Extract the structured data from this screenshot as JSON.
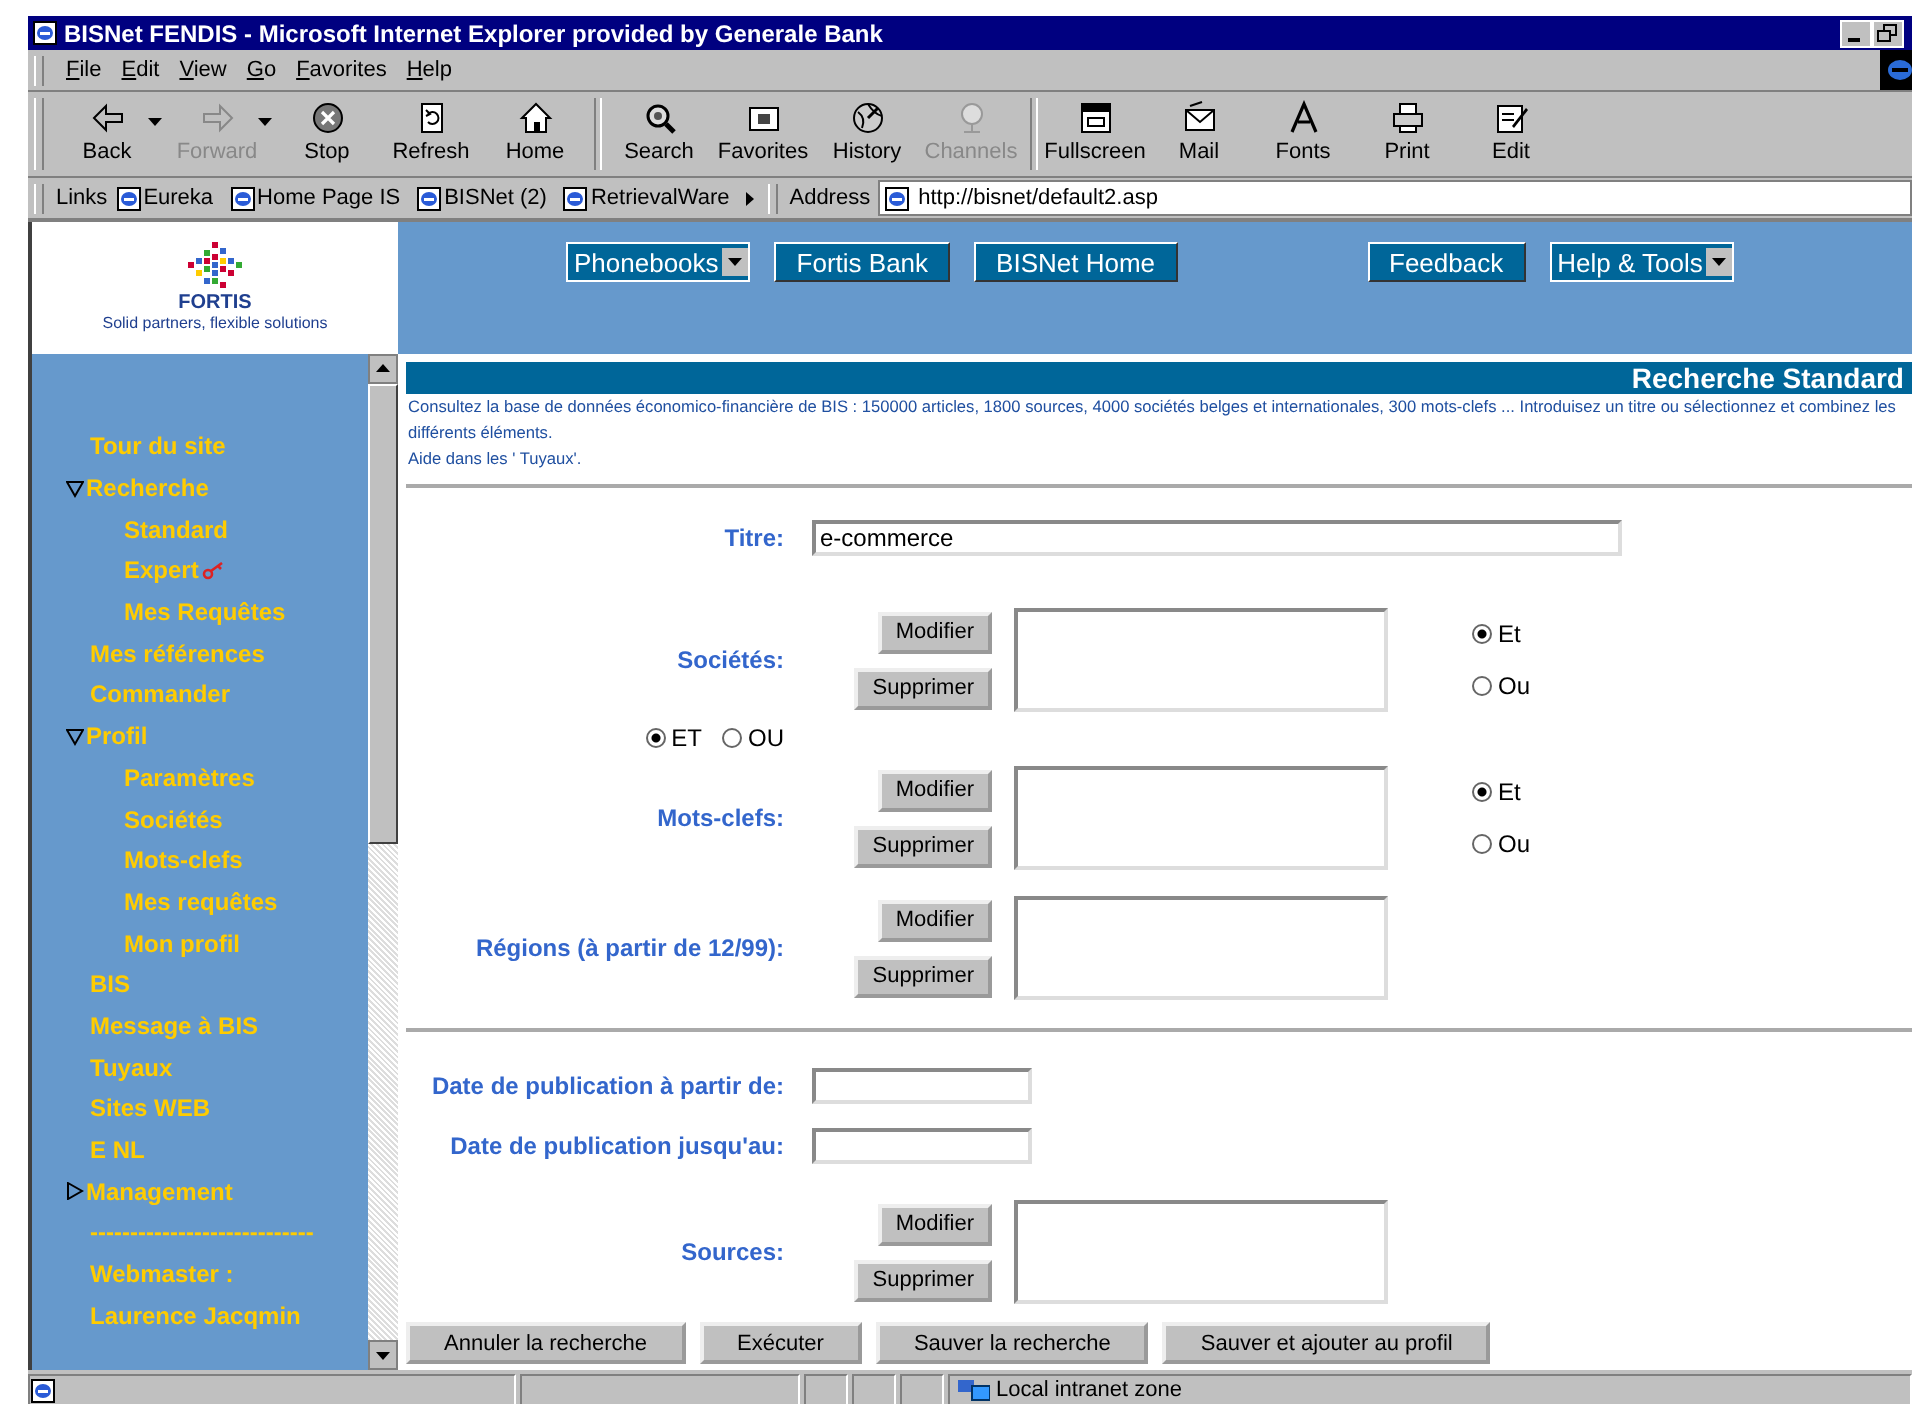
{
  "window": {
    "title": "BISNet FENDIS - Microsoft Internet Explorer provided by Generale Bank"
  },
  "menu": [
    "File",
    "Edit",
    "View",
    "Go",
    "Favorites",
    "Help"
  ],
  "toolbar": [
    [
      {
        "label": "Back",
        "disabled": false,
        "has_menu": true
      },
      {
        "label": "Forward",
        "disabled": true,
        "has_menu": true
      },
      {
        "label": "Stop",
        "disabled": false,
        "has_menu": false
      },
      {
        "label": "Refresh",
        "disabled": false,
        "has_menu": false
      },
      {
        "label": "Home",
        "disabled": false,
        "has_menu": false
      }
    ],
    [
      {
        "label": "Search",
        "disabled": false,
        "has_menu": false
      },
      {
        "label": "Favorites",
        "disabled": false,
        "has_menu": false
      },
      {
        "label": "History",
        "disabled": false,
        "has_menu": false
      },
      {
        "label": "Channels",
        "disabled": true,
        "has_menu": false
      }
    ],
    [
      {
        "label": "Fullscreen",
        "disabled": false,
        "has_menu": false
      },
      {
        "label": "Mail",
        "disabled": false,
        "has_menu": false
      },
      {
        "label": "Fonts",
        "disabled": false,
        "has_menu": false
      },
      {
        "label": "Print",
        "disabled": false,
        "has_menu": false
      },
      {
        "label": "Edit",
        "disabled": false,
        "has_menu": false
      }
    ]
  ],
  "links_bar": {
    "label": "Links",
    "links": [
      "Eureka",
      "Home Page IS",
      "BISNet (2)",
      "RetrievalWare"
    ],
    "address_label": "Address",
    "address": "http://bisnet/default2.asp"
  },
  "logo": {
    "name": "FORTIS",
    "tagline": "Solid partners, flexible solutions"
  },
  "banner_buttons": [
    {
      "label": "Phonebooks",
      "kind": "select"
    },
    {
      "label": "Fortis Bank",
      "kind": "button"
    },
    {
      "label": "BISNet Home",
      "kind": "button"
    },
    {
      "label": "Feedback",
      "kind": "button"
    },
    {
      "label": "Help & Tools",
      "kind": "select"
    }
  ],
  "nav": [
    {
      "label": "Tour du site"
    },
    {
      "label": "Recherche",
      "expanded": true,
      "children": [
        {
          "label": "Standard",
          "restricted": false
        },
        {
          "label": "Expert",
          "restricted": true
        },
        {
          "label": "Mes Requêtes",
          "restricted": false
        }
      ]
    },
    {
      "label": "Mes références"
    },
    {
      "label": "Commander"
    },
    {
      "label": "Profil",
      "expanded": true,
      "children": [
        {
          "label": "Paramètres",
          "restricted": false
        },
        {
          "label": "Sociétés",
          "restricted": false
        },
        {
          "label": "Mots-clefs",
          "restricted": false
        },
        {
          "label": "Mes requêtes",
          "restricted": false
        },
        {
          "label": "Mon profil",
          "restricted": false
        }
      ]
    },
    {
      "label": "BIS"
    },
    {
      "label": "Message à BIS"
    },
    {
      "label": "Tuyaux"
    },
    {
      "label": "Sites WEB"
    },
    {
      "label": "E NL"
    },
    {
      "label": "Management",
      "expanded": false
    },
    {
      "label": "----------------------------"
    },
    {
      "label": "Webmaster :"
    },
    {
      "label": "Laurence Jacqmin"
    }
  ],
  "page": {
    "title": "Recherche Standard",
    "intro": "Consultez la base de données économico-financière de BIS : 150000 articles, 1800 sources, 4000 sociétés belges et internationales, 300 mots-clefs ...  Introduisez un titre ou sélectionnez et combinez les différents éléments.",
    "help": "Aide dans les ' Tuyaux'."
  },
  "form": {
    "sections": [
      {
        "fields": [
          {
            "kind": "text",
            "label": "Titre:",
            "value": "e-commerce"
          },
          {
            "kind": "list",
            "label": "Sociétés:",
            "buttons": [
              "Modifier",
              "Supprimer"
            ],
            "options": [
              {
                "label": "Et",
                "selected": true
              },
              {
                "label": "Ou",
                "selected": false
              }
            ]
          },
          {
            "kind": "operator",
            "options": [
              {
                "label": "ET",
                "selected": true
              },
              {
                "label": "OU",
                "selected": false
              }
            ]
          },
          {
            "kind": "list",
            "label": "Mots-clefs:",
            "buttons": [
              "Modifier",
              "Supprimer"
            ],
            "options": [
              {
                "label": "Et",
                "selected": true
              },
              {
                "label": "Ou",
                "selected": false
              }
            ]
          },
          {
            "kind": "list",
            "label": "Régions (à partir de 12/99):",
            "buttons": [
              "Modifier",
              "Supprimer"
            ]
          }
        ]
      },
      {
        "fields": [
          {
            "kind": "date",
            "label": "Date de publication à partir de:"
          },
          {
            "kind": "date",
            "label": "Date de publication jusqu'au:"
          },
          {
            "kind": "list",
            "label": "Sources:",
            "buttons": [
              "Modifier",
              "Supprimer"
            ]
          }
        ]
      }
    ],
    "actions": [
      "Annuler la recherche",
      "Exécuter",
      "Sauver la recherche",
      "Sauver et ajouter au profil"
    ]
  },
  "status_bar": {
    "zone": "Local intranet zone"
  }
}
